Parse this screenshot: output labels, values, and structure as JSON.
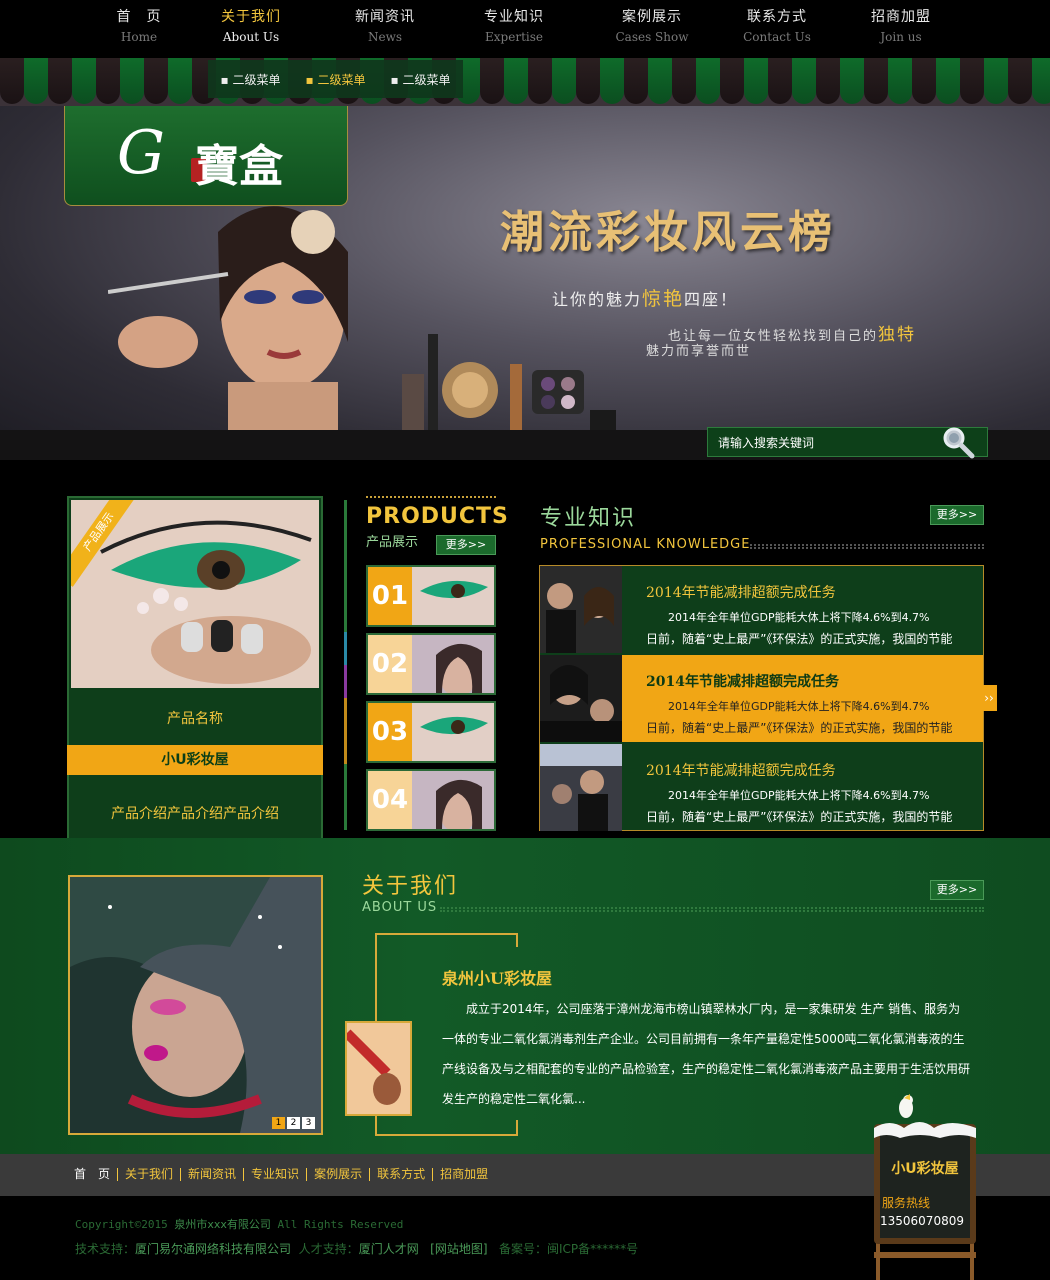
{
  "nav": {
    "items": [
      {
        "cn": "首　页",
        "en": "Home"
      },
      {
        "cn": "关于我们",
        "en": "About Us"
      },
      {
        "cn": "新闻资讯",
        "en": "News"
      },
      {
        "cn": "专业知识",
        "en": "Expertise"
      },
      {
        "cn": "案例展示",
        "en": "Cases Show"
      },
      {
        "cn": "联系方式",
        "en": "Contact Us"
      },
      {
        "cn": "招商加盟",
        "en": "Join us"
      }
    ],
    "submenu": [
      "二级菜单",
      "二级菜单",
      "二级菜单"
    ]
  },
  "logo": {
    "g": "G",
    "text": "寶盒"
  },
  "banner": {
    "title": "潮流彩妆风云榜",
    "line1_pre": "让你的魅力",
    "line1_em": "惊艳",
    "line1_post": "四座！",
    "line2_pre": "也让每一位女性轻松找到自己的",
    "line2_em": "独特",
    "line3": "魅力而享誉而世"
  },
  "search": {
    "placeholder": "请输入搜索关键词"
  },
  "product": {
    "ribbon": "产品展示",
    "name": "产品名称",
    "bar": "小U彩妆屋",
    "desc": "产品介绍产品介绍产品介绍",
    "head_en": "PRODUCTS",
    "head_cn": "产品展示",
    "more": "更多>>",
    "thumbs": [
      "01",
      "02",
      "03",
      "04"
    ]
  },
  "knowledge": {
    "title": "专业知识",
    "sub": "PROFESSIONAL KNOWLEDGE",
    "more": "更多>>",
    "arrow": "››",
    "items": [
      {
        "h": "2014年节能减排超额完成任务",
        "p1": "2014年全年单位GDP能耗大体上将下降4.6%到4.7%",
        "p2": "日前，随着“史上最严”《环保法》的正式实施，我国的节能"
      },
      {
        "h": "2014年节能减排超额完成任务",
        "p1": "2014年全年单位GDP能耗大体上将下降4.6%到4.7%",
        "p2": "日前，随着“史上最严”《环保法》的正式实施，我国的节能"
      },
      {
        "h": "2014年节能减排超额完成任务",
        "p1": "2014年全年单位GDP能耗大体上将下降4.6%到4.7%",
        "p2": "日前，随着“史上最严”《环保法》的正式实施，我国的节能"
      }
    ]
  },
  "about": {
    "title": "关于我们",
    "sub": "ABOUT US",
    "more": "更多>>",
    "heading": "泉州小U彩妆屋",
    "body": "成立于2014年，公司座落于漳州龙海市榜山镇翠林水厂内，是一家集研发 生产 销售、服务为一体的专业二氧化氯消毒剂生产企业。公司目前拥有一条年产量稳定性5000吨二氧化氯消毒液的生产线设备及与之相配套的专业的产品检验室，生产的稳定性二氧化氯消毒液产品主要用于生活饮用研发生产的稳定性二氧化氯...",
    "pages": [
      "1",
      "2",
      "3"
    ]
  },
  "footer": {
    "links": [
      "首　页",
      "关于我们",
      "新闻资讯",
      "专业知识",
      "案例展示",
      "联系方式",
      "招商加盟"
    ],
    "copyright_pre": "Copyright©2015",
    "copyright_company": "泉州市xxx有限公司",
    "copyright_post": "All Rights Reserved",
    "tech_label": "技术支持：",
    "tech_company": "厦门易尔通网络科技有限公司",
    "talent_label": "人才支持：",
    "talent_value": "厦门人才网",
    "sitemap": "[网站地图]",
    "icp": "备案号：闽ICP备******号"
  },
  "board": {
    "name": "小U彩妆屋",
    "label": "服务热线",
    "phone": "13506070809"
  },
  "colors": {
    "accent": "#f2c53d",
    "orange": "#f1a615",
    "green": "#0e3e1a"
  }
}
